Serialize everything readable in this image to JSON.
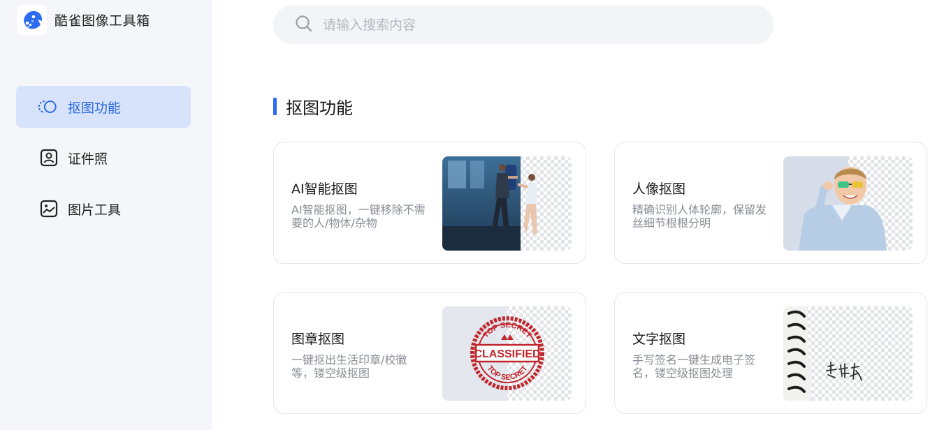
{
  "app": {
    "name": "酷雀图像工具箱"
  },
  "colors": {
    "accent": "#2d6cf0",
    "active_bg": "#d7e3fb",
    "sidebar_bg": "#f5f6fa"
  },
  "sidebar": {
    "items": [
      {
        "label": "抠图功能",
        "icon": "cutout-rings-icon",
        "active": true
      },
      {
        "label": "证件照",
        "icon": "id-photo-icon",
        "active": false
      },
      {
        "label": "图片工具",
        "icon": "image-tool-icon",
        "active": false
      }
    ]
  },
  "search": {
    "placeholder": "请输入搜索内容",
    "value": ""
  },
  "section": {
    "title": "抠图功能"
  },
  "cards": [
    {
      "title": "AI智能抠图",
      "desc": "AI智能抠图，一键移除不需要的人/物体/杂物"
    },
    {
      "title": "人像抠图",
      "desc": "精确识别人体轮廓，保留发丝细节根根分明"
    },
    {
      "title": "图章抠图",
      "desc": "一键抠出生活印章/校徽等，镂空级抠图"
    },
    {
      "title": "文字抠图",
      "desc": "手写签名一键生成电子签名，镂空级抠图处理"
    }
  ],
  "stamp": {
    "top": "TOP SECRET",
    "main": "CLASSIFIED",
    "bottom": "TOP SECRET"
  }
}
